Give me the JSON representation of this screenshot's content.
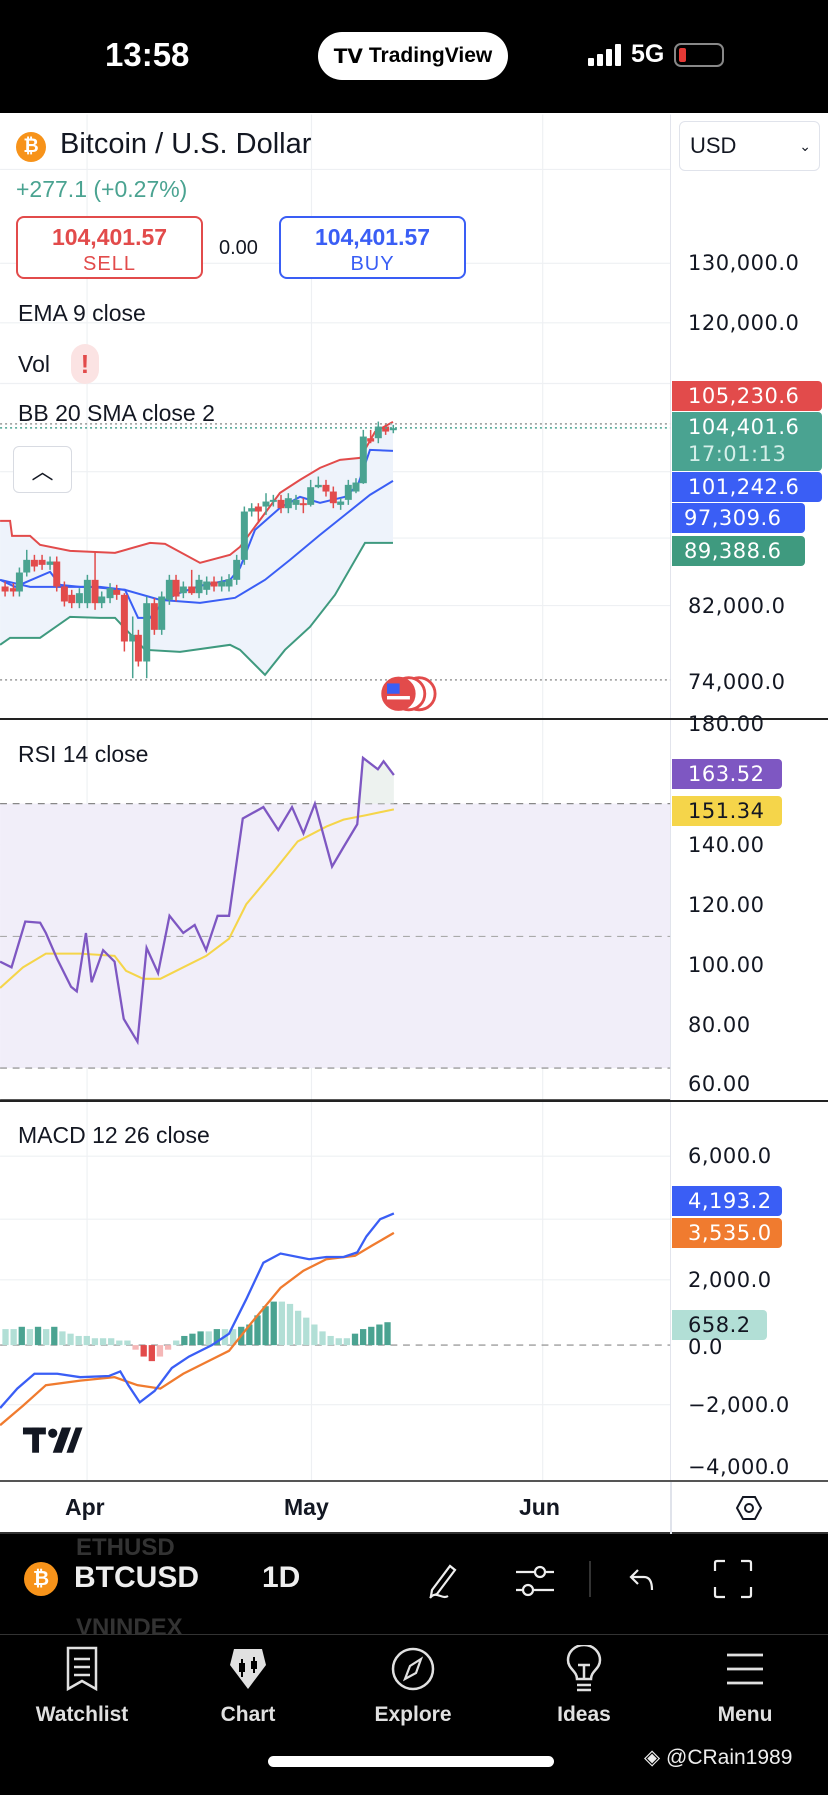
{
  "status_bar": {
    "time": "13:58",
    "app_badge": "TradingView",
    "network": "5G"
  },
  "header": {
    "title": "Bitcoin / U.S. Dollar",
    "change": "+277.1 (+0.27%)",
    "sell": {
      "price": "104,401.57",
      "label": "SELL"
    },
    "spread": "0.00",
    "buy": {
      "price": "104,401.57",
      "label": "BUY"
    },
    "currency": "USD"
  },
  "indicators": {
    "ema": "EMA 9 close",
    "vol": "Vol",
    "vol_warning": "!",
    "bb": "BB 20 SMA close 2",
    "rsi": "RSI 14 close",
    "macd": "MACD 12 26 close"
  },
  "price_axis": {
    "labels": [
      "130,000.0",
      "120,000.0",
      "82,000.0",
      "74,000.0"
    ],
    "tags": {
      "bb_upper": "105,230.6",
      "last": "104,401.6",
      "countdown": "17:01:13",
      "ema": "101,242.6",
      "bb_basis": "97,309.6",
      "bb_lower": "89,388.6"
    },
    "colors": {
      "red": "#e24b4b",
      "green": "#4aa391",
      "blue": "#3a5ef5",
      "lower": "#3f9a7f"
    }
  },
  "rsi_axis": {
    "labels": [
      "180.00",
      "140.00",
      "120.00",
      "100.00",
      "80.00",
      "60.00"
    ],
    "rsi_value": "163.52",
    "rsi_ma_value": "151.34",
    "colors": {
      "rsi": "#7e57c2",
      "ma": "#f5d54a"
    }
  },
  "macd_axis": {
    "labels": [
      "6,000.0",
      "2,000.0",
      "0.0",
      "−2,000.0",
      "−4,000.0"
    ],
    "macd_value": "4,193.2",
    "signal_value": "3,535.0",
    "hist_value": "658.2",
    "colors": {
      "macd": "#3a5ef5",
      "signal": "#f07b2f",
      "hist": "#b2dfd6"
    }
  },
  "time_axis": {
    "labels": [
      "Apr",
      "May",
      "Jun"
    ]
  },
  "toolbar": {
    "symbol": "BTCUSD",
    "interval": "1D",
    "prev_symbol": "ETHUSD",
    "next_symbol": "VNINDEX"
  },
  "nav": [
    {
      "label": "Watchlist"
    },
    {
      "label": "Chart"
    },
    {
      "label": "Explore"
    },
    {
      "label": "Ideas"
    },
    {
      "label": "Menu"
    }
  ],
  "watermark": "@CRain1989"
}
